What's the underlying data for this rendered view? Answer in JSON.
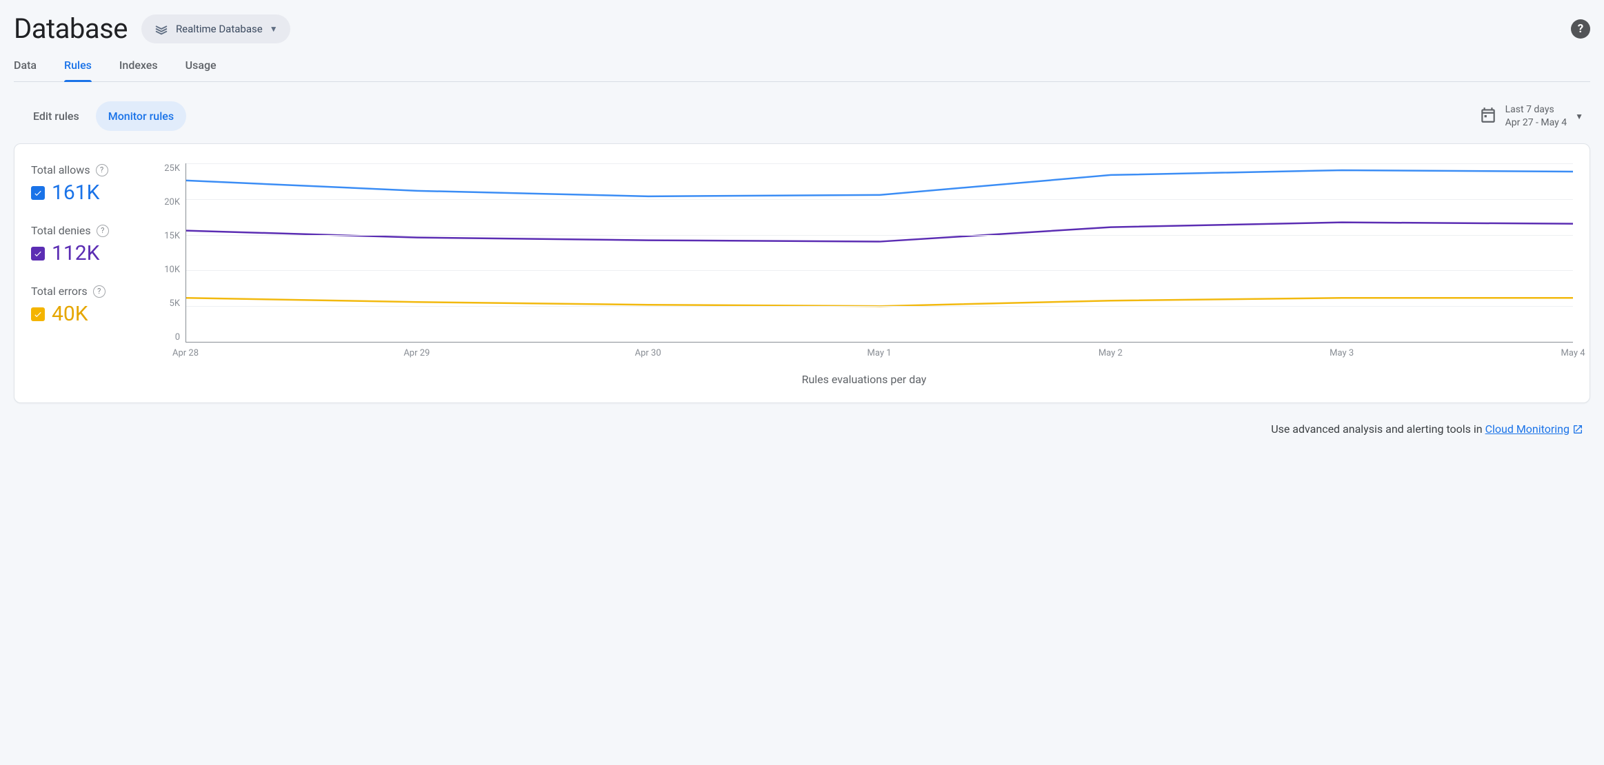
{
  "header": {
    "title": "Database",
    "db_selector_label": "Realtime Database"
  },
  "top_tabs": [
    {
      "label": "Data",
      "active": false
    },
    {
      "label": "Rules",
      "active": true
    },
    {
      "label": "Indexes",
      "active": false
    },
    {
      "label": "Usage",
      "active": false
    }
  ],
  "sub_tabs": [
    {
      "label": "Edit rules",
      "active": false
    },
    {
      "label": "Monitor rules",
      "active": true
    }
  ],
  "date_picker": {
    "range_label": "Last 7 days",
    "range_dates": "Apr 27 - May 4"
  },
  "legend": {
    "allows": {
      "label": "Total allows",
      "value": "161K",
      "color": "#1a73e8"
    },
    "denies": {
      "label": "Total denies",
      "value": "112K",
      "color": "#5b2db3"
    },
    "errors": {
      "label": "Total errors",
      "value": "40K",
      "color": "#f4b400"
    }
  },
  "footer": {
    "prefix": "Use advanced analysis and alerting tools in ",
    "link_label": "Cloud Monitoring"
  },
  "chart_data": {
    "type": "line",
    "title": "Rules evaluations per day",
    "xlabel": "",
    "ylabel": "",
    "ylim": [
      0,
      26000
    ],
    "y_ticks": [
      "25K",
      "20K",
      "15K",
      "10K",
      "5K",
      "0"
    ],
    "categories": [
      "Apr 28",
      "Apr 29",
      "Apr 30",
      "May 1",
      "May 2",
      "May 3",
      "May 4"
    ],
    "series": [
      {
        "name": "Total allows",
        "color": "#3b8df5",
        "values": [
          23500,
          22000,
          21200,
          21400,
          24300,
          25000,
          24800
        ]
      },
      {
        "name": "Total denies",
        "color": "#5b2db3",
        "values": [
          16200,
          15200,
          14800,
          14600,
          16700,
          17400,
          17200
        ]
      },
      {
        "name": "Total errors",
        "color": "#f2b90f",
        "values": [
          6400,
          5800,
          5400,
          5200,
          6000,
          6400,
          6400
        ]
      }
    ]
  }
}
